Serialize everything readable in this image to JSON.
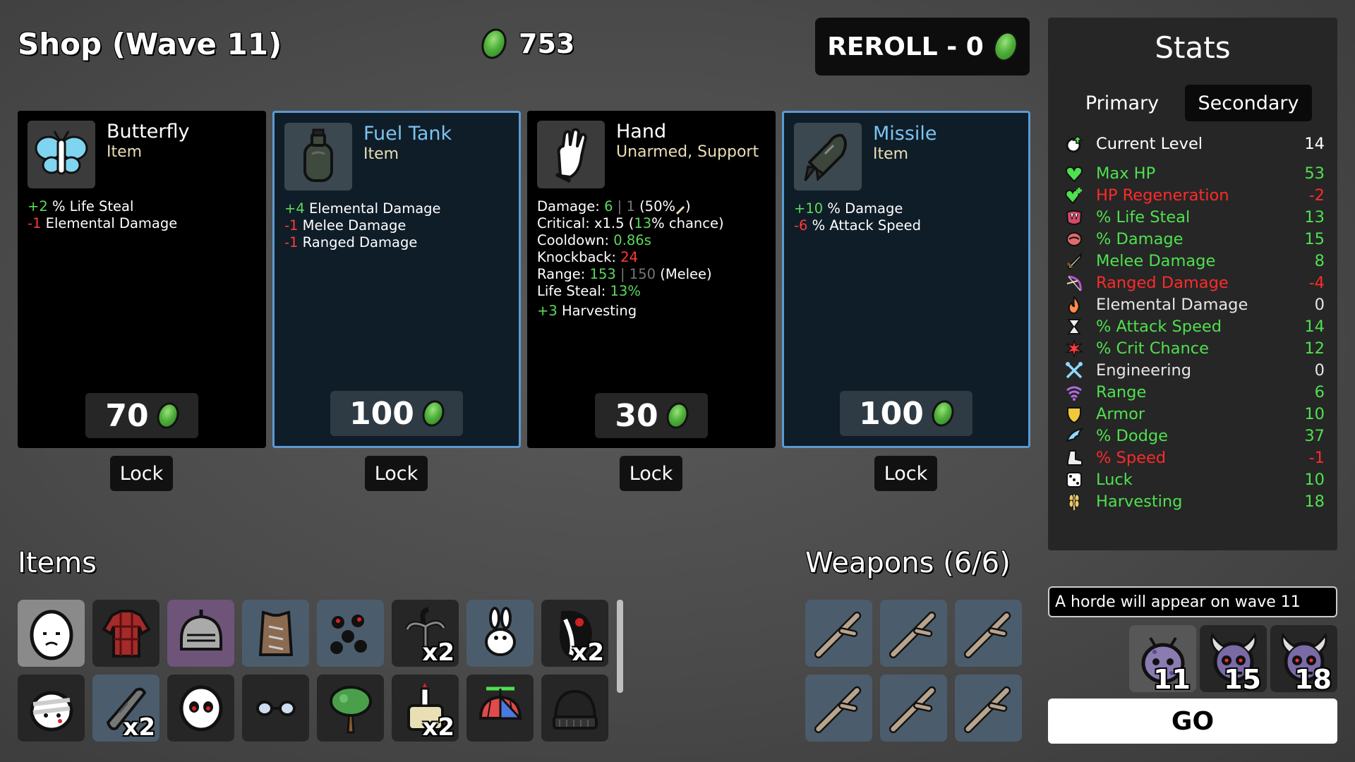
{
  "header": {
    "title": "Shop (Wave 11)",
    "materials": "753",
    "reroll_label": "REROLL - 0"
  },
  "shop": [
    {
      "name": "Butterfly",
      "type": "Item",
      "icon": "butterfly-icon",
      "price": "70",
      "lock": "Lock",
      "effects": [
        {
          "v": "+2",
          "c": "pos",
          "t": " % Life Steal"
        },
        {
          "v": "-1",
          "c": "neg",
          "t": " Elemental Damage"
        }
      ]
    },
    {
      "name": "Fuel Tank",
      "type": "Item",
      "icon": "fuel-tank-icon",
      "price": "100",
      "lock": "Lock",
      "effects": [
        {
          "v": "+4",
          "c": "pos",
          "t": " Elemental Damage"
        },
        {
          "v": "-1",
          "c": "neg",
          "t": " Melee Damage"
        },
        {
          "v": "-1",
          "c": "neg",
          "t": " Ranged Damage"
        }
      ]
    },
    {
      "name": "Hand",
      "type": "Unarmed, Support",
      "icon": "hand-icon",
      "price": "30",
      "lock": "Lock",
      "weapon_stats": {
        "damage_label": "Damage: ",
        "damage_a": "6",
        "damage_sep": " | ",
        "damage_b": "1",
        "damage_c": " (50%",
        "crit_label": "Critical: ",
        "crit_a": "x1.5 (",
        "crit_b": "13",
        "crit_c": "% chance)",
        "cooldown_label": "Cooldown: ",
        "cooldown_v": "0.86s",
        "knockback_label": "Knockback: ",
        "knockback_v": "24",
        "range_label": "Range: ",
        "range_a": "153",
        "range_sep": " | ",
        "range_b": "150",
        "range_c": " (Melee)",
        "lifesteal_label": "Life Steal: ",
        "lifesteal_v": "13%",
        "harvest_v": "+3",
        "harvest_t": " Harvesting"
      }
    },
    {
      "name": "Missile",
      "type": "Item",
      "icon": "missile-icon",
      "price": "100",
      "lock": "Lock",
      "effects": [
        {
          "v": "+10",
          "c": "pos",
          "t": " % Damage"
        },
        {
          "v": "-6",
          "c": "neg",
          "t": " % Attack Speed"
        }
      ]
    }
  ],
  "stats": {
    "title": "Stats",
    "tab_primary": "Primary",
    "tab_secondary": "Secondary",
    "level_label": "Current Level",
    "level_value": "14",
    "rows": [
      {
        "label": "Max HP",
        "value": "53",
        "color": "#4fe04f",
        "icon": "heart-icon"
      },
      {
        "label": "HP Regeneration",
        "value": "-2",
        "color": "#ff2a2a",
        "icon": "regen-heart-icon"
      },
      {
        "label": "% Life Steal",
        "value": "13",
        "color": "#4fe04f",
        "icon": "fangs-icon"
      },
      {
        "label": "% Damage",
        "value": "15",
        "color": "#4fe04f",
        "icon": "muscle-icon"
      },
      {
        "label": "Melee Damage",
        "value": "8",
        "color": "#4fe04f",
        "icon": "sword-icon"
      },
      {
        "label": "Ranged Damage",
        "value": "-4",
        "color": "#ff2a2a",
        "icon": "bow-icon"
      },
      {
        "label": "Elemental Damage",
        "value": "0",
        "color": "#e6e6e6",
        "icon": "flame-icon"
      },
      {
        "label": "% Attack Speed",
        "value": "14",
        "color": "#4fe04f",
        "icon": "hourglass-icon"
      },
      {
        "label": "% Crit Chance",
        "value": "12",
        "color": "#4fe04f",
        "icon": "crit-burst-icon"
      },
      {
        "label": "Engineering",
        "value": "0",
        "color": "#e6e6e6",
        "icon": "wrench-cross-icon"
      },
      {
        "label": "Range",
        "value": "6",
        "color": "#4fe04f",
        "icon": "range-waves-icon"
      },
      {
        "label": "Armor",
        "value": "10",
        "color": "#4fe04f",
        "icon": "shield-icon"
      },
      {
        "label": "% Dodge",
        "value": "37",
        "color": "#4fe04f",
        "icon": "dodge-wing-icon"
      },
      {
        "label": "% Speed",
        "value": "-1",
        "color": "#ff2a2a",
        "icon": "boot-icon"
      },
      {
        "label": "Luck",
        "value": "10",
        "color": "#4fe04f",
        "icon": "dice-icon"
      },
      {
        "label": "Harvesting",
        "value": "18",
        "color": "#4fe04f",
        "icon": "wheat-icon"
      }
    ]
  },
  "items": {
    "title": "Items",
    "list": [
      {
        "icon": "egg-face-icon",
        "bg": "gray",
        "qty": ""
      },
      {
        "icon": "plaid-shirt-icon",
        "bg": "dark",
        "qty": ""
      },
      {
        "icon": "knight-helmet-icon",
        "bg": "purple",
        "qty": ""
      },
      {
        "icon": "leather-vest-icon",
        "bg": "blue",
        "qty": ""
      },
      {
        "icon": "blood-drops-icon",
        "bg": "blue",
        "qty": ""
      },
      {
        "icon": "claw-tree-icon",
        "bg": "dark",
        "qty": "x2"
      },
      {
        "icon": "rabbit-icon",
        "bg": "blue",
        "qty": ""
      },
      {
        "icon": "fang-mouth-icon",
        "bg": "dark",
        "qty": "x2"
      },
      {
        "icon": "bandaged-face-icon",
        "bg": "dark",
        "qty": ""
      },
      {
        "icon": "wooden-plank-icon",
        "bg": "blue",
        "qty": "x2"
      },
      {
        "icon": "ghost-mask-icon",
        "bg": "dark",
        "qty": ""
      },
      {
        "icon": "glasses-icon",
        "bg": "dark",
        "qty": ""
      },
      {
        "icon": "tree-icon",
        "bg": "dark",
        "qty": ""
      },
      {
        "icon": "scroll-candle-icon",
        "bg": "dark",
        "qty": "x2"
      },
      {
        "icon": "propeller-cap-icon",
        "bg": "dark",
        "qty": ""
      },
      {
        "icon": "beanie-icon",
        "bg": "dark",
        "qty": ""
      }
    ]
  },
  "weapons": {
    "title": "Weapons (6/6)",
    "list": [
      "stick-icon",
      "stick-icon",
      "stick-icon",
      "stick-icon",
      "stick-icon",
      "stick-icon"
    ]
  },
  "horde": {
    "text": "A horde will appear on wave 11",
    "enemies": [
      {
        "icon": "spotted-blob-icon",
        "count": "11",
        "bg": "#575757"
      },
      {
        "icon": "horned-skull-icon",
        "count": "15",
        "bg": "#262626"
      },
      {
        "icon": "horned-skull-icon",
        "count": "18",
        "bg": "#262626"
      }
    ]
  },
  "go_label": "GO",
  "colors": {
    "positive": "#5cd95c",
    "negative": "#ff3b3b",
    "card_blue_border": "#5b9ad1",
    "name_blue": "#7cc3f0",
    "material_green": "#4fb03b"
  }
}
